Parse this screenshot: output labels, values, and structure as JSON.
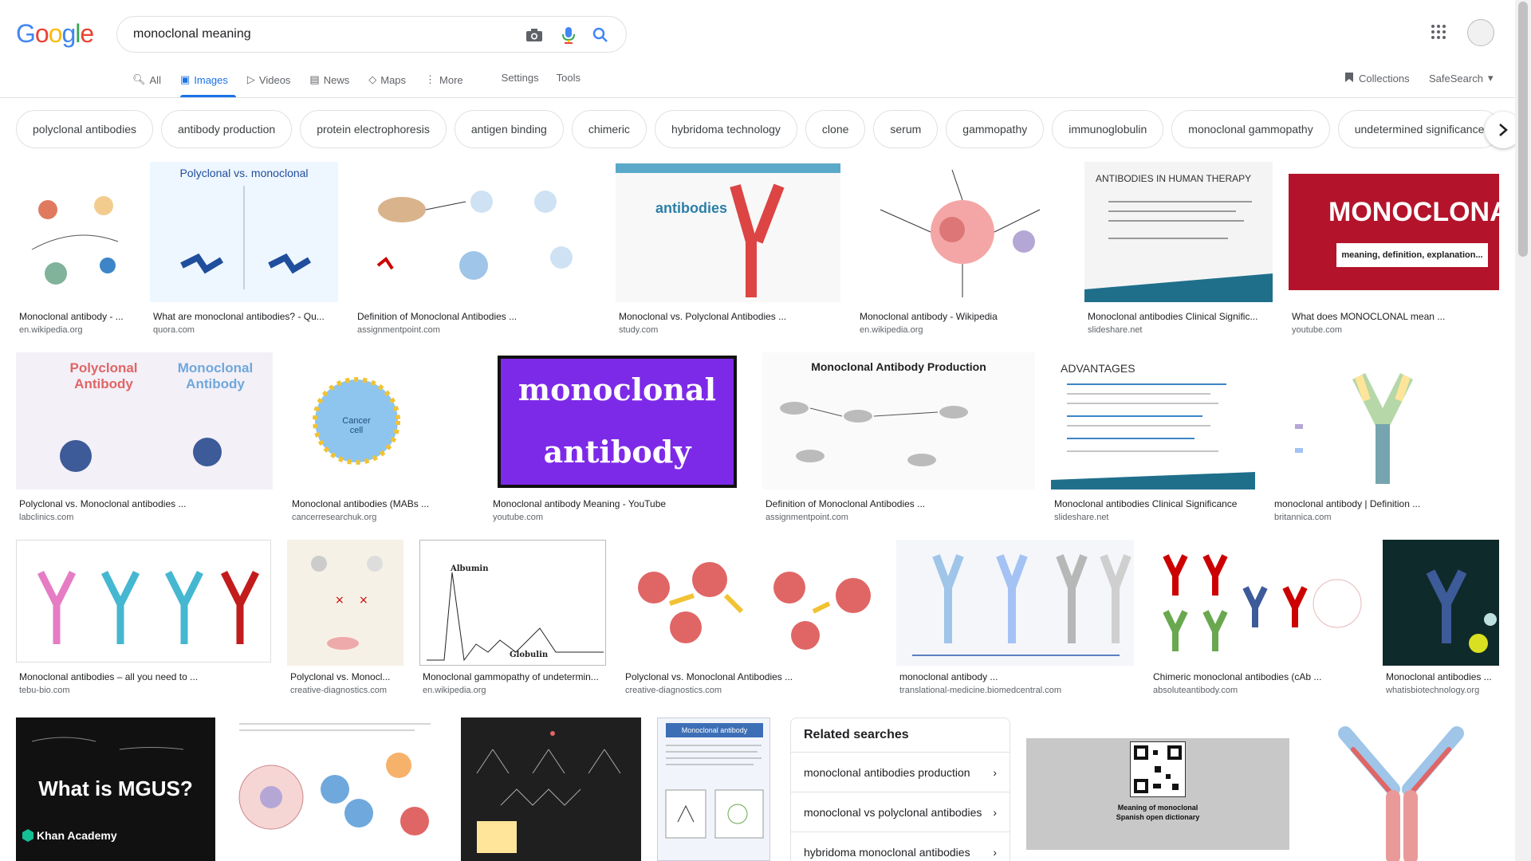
{
  "search": {
    "query": "monoclonal meaning"
  },
  "tabs": [
    {
      "label": "All",
      "icon": "search-icon"
    },
    {
      "label": "Images",
      "icon": "image-icon"
    },
    {
      "label": "Videos",
      "icon": "video-icon"
    },
    {
      "label": "News",
      "icon": "news-icon"
    },
    {
      "label": "Maps",
      "icon": "map-icon"
    },
    {
      "label": "More",
      "icon": "more-icon"
    }
  ],
  "tools": {
    "settings": "Settings",
    "tools": "Tools",
    "collections": "Collections",
    "safesearch": "SafeSearch"
  },
  "chips": [
    "polyclonal antibodies",
    "antibody production",
    "protein electrophoresis",
    "antigen binding",
    "chimeric",
    "hybridoma technology",
    "clone",
    "serum",
    "gammopathy",
    "immunoglobulin",
    "monoclonal gammopathy",
    "undetermined significance"
  ],
  "images": [
    {
      "caption": "Monoclonal antibody - ...",
      "source": "en.wikipedia.org"
    },
    {
      "caption": "What are monoclonal antibodies? - Qu...",
      "source": "quora.com",
      "text": "Polyclonal vs. monoclonal"
    },
    {
      "caption": "Definition of Monoclonal Antibodies ...",
      "source": "assignmentpoint.com"
    },
    {
      "caption": "Monoclonal vs. Polyclonal Antibodies ...",
      "source": "study.com",
      "text": "antibodies"
    },
    {
      "caption": "Monoclonal antibody - Wikipedia",
      "source": "en.wikipedia.org"
    },
    {
      "caption": "Monoclonal antibodies Clinical Signific...",
      "source": "slideshare.net",
      "text": "ANTIBODIES IN HUMAN THERAPY"
    },
    {
      "caption": "What does MONOCLONAL mean ...",
      "source": "youtube.com",
      "text": "MONOCLONAL",
      "subtext": "meaning, definition, explanation..."
    },
    {
      "caption": "Polyclonal vs. Monoclonal antibodies ...",
      "source": "labclinics.com",
      "text": "Polyclonal Antibody",
      "text2": "Monoclonal Antibody"
    },
    {
      "caption": "Monoclonal antibodies (MABs ...",
      "source": "cancerresearchuk.org",
      "text": "Cancer cell"
    },
    {
      "caption": "Monoclonal antibody Meaning - YouTube",
      "source": "youtube.com",
      "text": "monoclonal",
      "subtext": "antibody"
    },
    {
      "caption": "Definition of Monoclonal Antibodies ...",
      "source": "assignmentpoint.com",
      "text": "Monoclonal Antibody Production"
    },
    {
      "caption": "Monoclonal antibodies Clinical Significance",
      "source": "slideshare.net",
      "text": "ADVANTAGES"
    },
    {
      "caption": "monoclonal antibody | Definition ...",
      "source": "britannica.com"
    },
    {
      "caption": "Monoclonal antibodies – all you need to ...",
      "source": "tebu-bio.com"
    },
    {
      "caption": "Polyclonal vs. Monocl...",
      "source": "creative-diagnostics.com"
    },
    {
      "caption": "Monoclonal gammopathy of undetermin...",
      "source": "en.wikipedia.org",
      "text": "Albumin",
      "subtext": "Globulin"
    },
    {
      "caption": "Polyclonal vs. Monoclonal Antibodies ...",
      "source": "creative-diagnostics.com"
    },
    {
      "caption": "monoclonal antibody ...",
      "source": "translational-medicine.biomedcentral.com"
    },
    {
      "caption": "Chimeric monoclonal antibodies (cAb ...",
      "source": "absoluteantibody.com"
    },
    {
      "caption": "Monoclonal antibodies ...",
      "source": "whatisbiotechnology.org"
    },
    {
      "text": "What is MGUS?",
      "subtext": "Khan Academy"
    },
    {},
    {},
    {
      "text": "Monoclonal antibody"
    },
    {
      "text": "Meaning of monoclonal",
      "subtext": "Spanish open dictionary"
    },
    {}
  ],
  "related": {
    "title": "Related searches",
    "items": [
      "monoclonal antibodies production",
      "monoclonal vs polyclonal antibodies",
      "hybridoma monoclonal antibodies"
    ]
  }
}
